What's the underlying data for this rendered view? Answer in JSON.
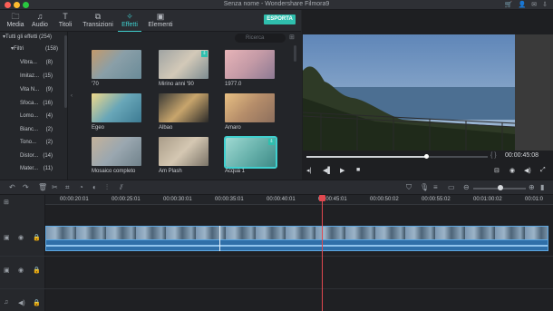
{
  "window": {
    "title": "Senza nome - Wondershare Filmora9"
  },
  "tabs": [
    {
      "label": "Media",
      "icon": "folder-icon"
    },
    {
      "label": "Audio",
      "icon": "music-note-icon"
    },
    {
      "label": "Titoli",
      "icon": "text-icon"
    },
    {
      "label": "Transizioni",
      "icon": "transition-icon"
    },
    {
      "label": "Effetti",
      "icon": "effects-icon",
      "active": true
    },
    {
      "label": "Elementi",
      "icon": "image-icon"
    }
  ],
  "export_label": "ESPORTA",
  "tree": {
    "root": {
      "label": "Tutti gli effetti",
      "count": "(254)"
    },
    "filters": {
      "label": "Filtri",
      "count": "(158)"
    },
    "items": [
      {
        "label": "Vibra...",
        "count": "(8)"
      },
      {
        "label": "Imitaz...",
        "count": "(15)"
      },
      {
        "label": "Vita N...",
        "count": "(9)"
      },
      {
        "label": "Sfoca...",
        "count": "(16)"
      },
      {
        "label": "Lomo...",
        "count": "(4)"
      },
      {
        "label": "Bianc...",
        "count": "(2)"
      },
      {
        "label": "Tono...",
        "count": "(2)"
      },
      {
        "label": "Distor...",
        "count": "(14)"
      },
      {
        "label": "Mater...",
        "count": "(11)"
      }
    ]
  },
  "search": {
    "placeholder": "Ricerca"
  },
  "effects": [
    {
      "label": "'70"
    },
    {
      "label": "Mirino anni '90"
    },
    {
      "label": "1977.0"
    },
    {
      "label": "Egeo"
    },
    {
      "label": "Albao"
    },
    {
      "label": "Amaro"
    },
    {
      "label": "Mosaico completo"
    },
    {
      "label": "Am Plash"
    },
    {
      "label": "Acqua 1"
    }
  ],
  "preview": {
    "timecode": "00:00:45:08",
    "progress": 0.66
  },
  "ruler": [
    "00:00:20:01",
    "00:00:25:01",
    "00:00:30:01",
    "00:00:35:01",
    "00:00:40:01",
    "00:00:45:01",
    "00:00:50:02",
    "00:00:55:02",
    "00:01:00:02",
    "00:01:0"
  ],
  "colors": {
    "accent": "#3fd0cf",
    "export": "#2fbfae",
    "clip": "#2f6fa8",
    "playhead": "#e0484f"
  }
}
